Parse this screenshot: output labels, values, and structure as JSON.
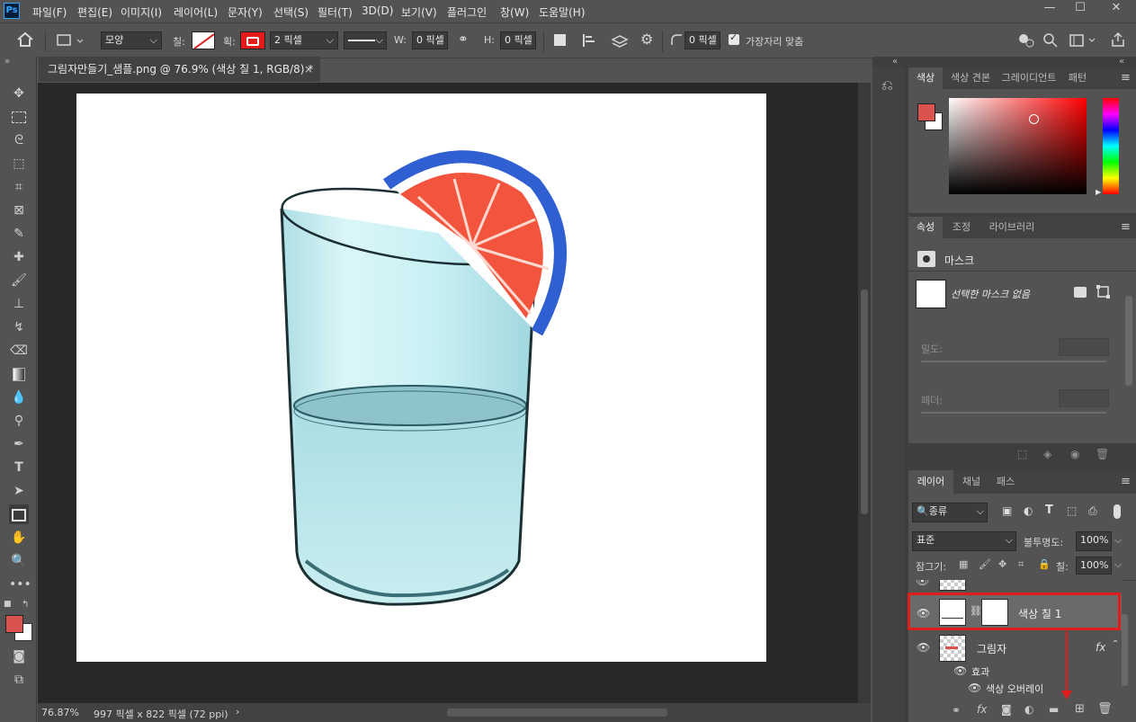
{
  "app": {
    "logo": "Ps"
  },
  "menu": [
    "파일(F)",
    "편집(E)",
    "이미지(I)",
    "레이어(L)",
    "문자(Y)",
    "선택(S)",
    "필터(T)",
    "3D(D)",
    "보기(V)",
    "플러그인",
    "창(W)",
    "도움말(H)"
  ],
  "window_controls": {
    "minimize": "—",
    "maximize": "☐",
    "close": "✕"
  },
  "options": {
    "shape_mode": "모양",
    "fill_label": "칠:",
    "stroke_label": "획:",
    "stroke_width": "2 픽셀",
    "w_label": "W:",
    "w_value": "0 픽셀",
    "h_label": "H:",
    "h_value": "0 픽셀",
    "radius_value": "0 픽셀",
    "align_edges_label": "가장자리 맞춤",
    "stroke_color": "#e31b1b"
  },
  "document": {
    "tab_title": "그림자만들기_샘플.png @ 76.9% (색상 칠 1, RGB/8) *",
    "close": "×",
    "zoom": "76.87%",
    "doc_size": "997 픽셀 x 822 픽셀 (72 ppi)"
  },
  "colors": {
    "foreground": "#d9534f",
    "background": "#ffffff"
  },
  "color_panel": {
    "tabs": [
      "색상",
      "색상 견본",
      "그레이디언트",
      "패턴"
    ],
    "active": 0
  },
  "properties_panel": {
    "tabs": [
      "속성",
      "조정",
      "라이브러리"
    ],
    "type_label": "마스크",
    "no_mask_text": "선택한 마스크 없음",
    "density_label": "밀도:",
    "feather_label": "페더:"
  },
  "layers_panel": {
    "tabs": [
      "레이어",
      "채널",
      "패스"
    ],
    "filter_kind": "종류",
    "blend_mode": "표준",
    "opacity_label": "불투명도:",
    "opacity_value": "100%",
    "lock_label": "잠그기:",
    "fill_label": "칠:",
    "fill_value": "100%",
    "layers": [
      {
        "name": "색상 칠 1"
      },
      {
        "name": "그림자",
        "fx": "fx"
      }
    ],
    "effects_label": "효과",
    "effect_item": "색상 오버레이"
  }
}
